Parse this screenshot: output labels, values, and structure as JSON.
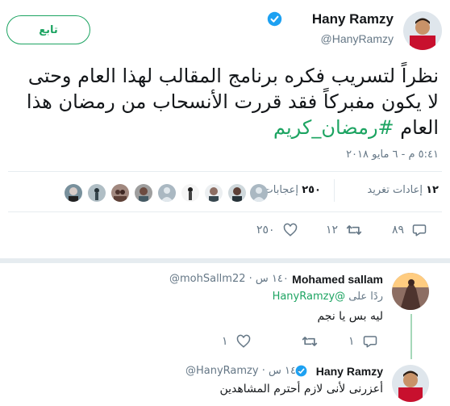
{
  "tweet": {
    "author_name": "Hany Ramzy",
    "author_handle": "@HanyRamzy",
    "follow_label": "تابع",
    "text_part1": "نظراً لتسريب فكره برنامج المقالب لهذا العام وحتى لا يكون مفبركاً فقد قررت الأنسحاب من رمضان هذا العام ",
    "hashtag": "#رمضان_كريم",
    "timestamp": "٥:٤١ م - ٦ مايو ٢٠١٨"
  },
  "stats": {
    "retweets_count": "١٢",
    "retweets_label": "إعادات تغريد",
    "likes_count": "٢٥٠",
    "likes_label": "إعجابات"
  },
  "actions": {
    "reply_count": "٨٩",
    "retweet_count": "١٢",
    "like_count": "٢٥٠"
  },
  "replies": [
    {
      "name": "Mohamed sallam",
      "handle": "@mohSallm22",
      "time": "١٤٠ س",
      "replying_to_label": "ردًا على",
      "replying_to_handle": "@HanyRamzy",
      "text": "ليه بس يا نجم",
      "reply_count": "١",
      "like_count": "١"
    },
    {
      "name": "Hany Ramzy",
      "handle": "@HanyRamzy",
      "time": "١٤٠ س",
      "text": "أعزرنى لأنى لازم أحترم المشاهدين"
    }
  ],
  "colors": {
    "accent": "#1da462",
    "verified": "#1da1f2",
    "muted": "#657786"
  }
}
